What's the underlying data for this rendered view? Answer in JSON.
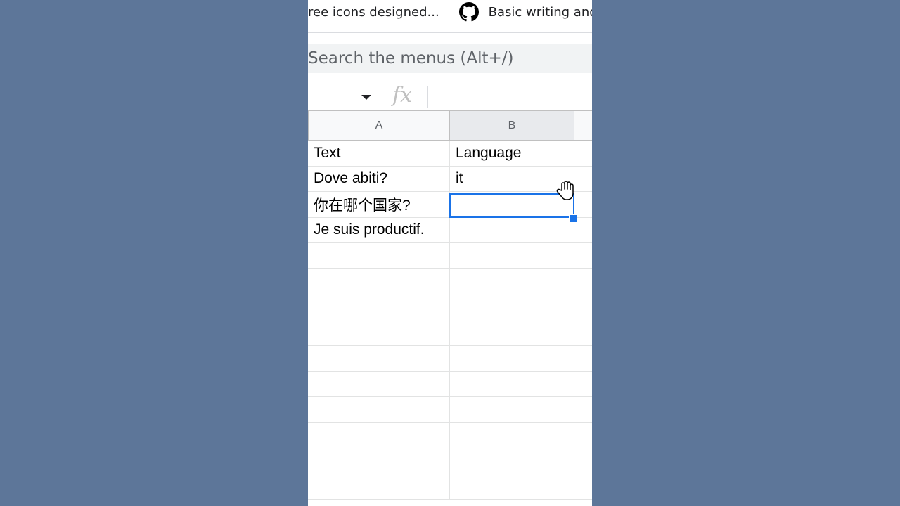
{
  "bookmarks": [
    {
      "label": "ree icons designed..."
    },
    {
      "label": "Basic writing and",
      "icon": "github-icon"
    }
  ],
  "menu_search": {
    "placeholder": "Search the menus (Alt+/)"
  },
  "formula_bar": {
    "fx_label": "fx",
    "name_box_value": "",
    "formula_value": ""
  },
  "columns": [
    "A",
    "B"
  ],
  "rows": [
    {
      "a": "Text",
      "b": "Language"
    },
    {
      "a": "Dove abiti?",
      "b": "it"
    },
    {
      "a": "你在哪个国家?",
      "b": ""
    },
    {
      "a": "Je suis productif.",
      "b": ""
    }
  ],
  "selected_cell": "B3",
  "colors": {
    "background": "#5d7699",
    "selection": "#1a73e8"
  }
}
